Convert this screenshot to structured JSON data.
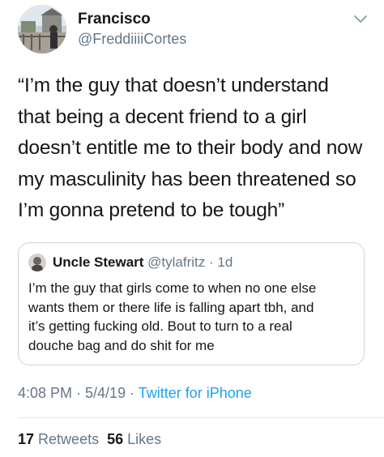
{
  "author": {
    "display_name": "Francisco",
    "handle": "@FreddiiiiCortes"
  },
  "tweet": {
    "text": "“I’m the guy that doesn’t understand\nthat being a decent friend to a girl\ndoesn’t entitle me to their body and now\nmy masculinity has been threatened so\nI’m gonna pretend to be tough”"
  },
  "quoted_tweet": {
    "display_name": "Uncle Stewart",
    "handle_time": "@tylafritz · 1d",
    "text": "I’m the guy that girls come to when no one else\nwants them or there life is falling apart tbh, and\nit’s getting fucking old. Bout to turn to a real\ndouche bag and do shit for me"
  },
  "meta": {
    "datetime": "4:08 PM · 5/4/19 · ",
    "source": "Twitter for iPhone"
  },
  "stats": {
    "retweets_count": "17",
    "retweets_label": "Retweets",
    "likes_count": "56",
    "likes_label": "Likes"
  },
  "icons": {
    "menu": "chevron-down-icon"
  },
  "colors": {
    "text": "#14171a",
    "secondary": "#657786",
    "link": "#1da1f2",
    "border": "#ccd6dd"
  }
}
